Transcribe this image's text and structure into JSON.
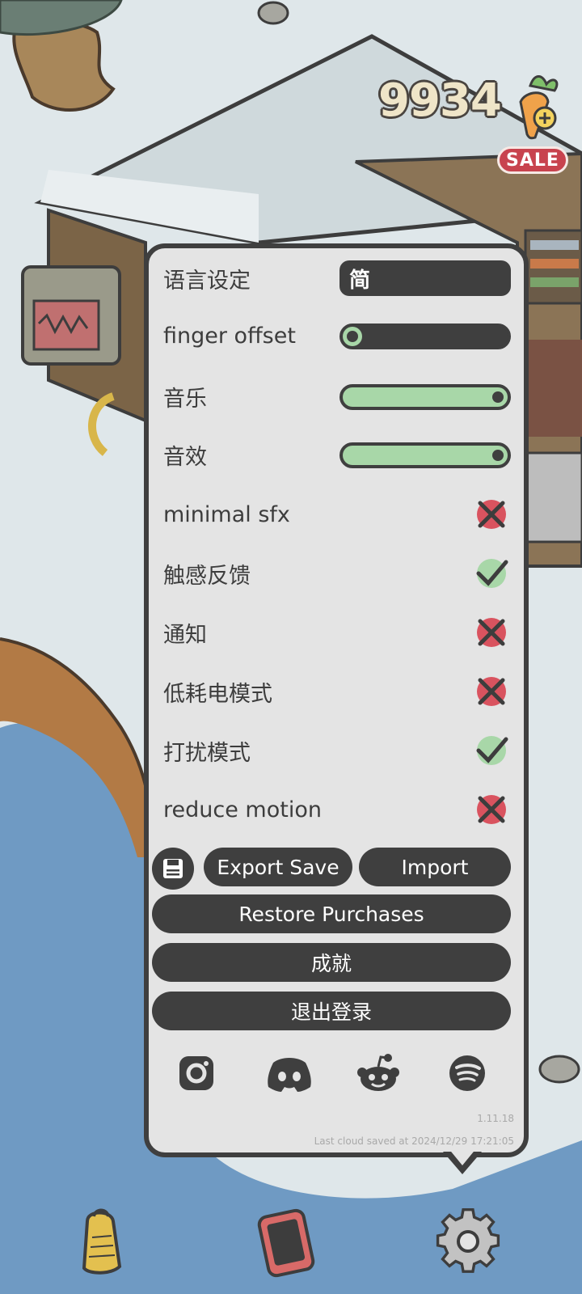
{
  "hud": {
    "carrots": "9934",
    "sale_badge": "SALE"
  },
  "settings": {
    "language": {
      "label": "语言设定",
      "value": "简"
    },
    "finger_offset": {
      "label": "finger offset",
      "level": 0.12
    },
    "music": {
      "label": "音乐",
      "level": 1.0
    },
    "sfx": {
      "label": "音效",
      "level": 1.0
    },
    "toggles": [
      {
        "label": "minimal sfx",
        "on": false
      },
      {
        "label": "触感反馈",
        "on": true
      },
      {
        "label": "通知",
        "on": false
      },
      {
        "label": "低耗电模式",
        "on": false
      },
      {
        "label": "打扰模式",
        "on": true
      },
      {
        "label": "reduce motion",
        "on": false
      }
    ],
    "buttons": {
      "export_save": "Export Save",
      "import": "Import",
      "restore_purchases": "Restore Purchases",
      "achievements": "成就",
      "logout": "退出登录"
    },
    "social_icons": [
      "instagram-icon",
      "discord-icon",
      "reddit-icon",
      "spotify-icon"
    ],
    "version": "1.11.18",
    "cloud_save": "Last cloud saved at 2024/12/29 17:21:05"
  },
  "dock": [
    "backpack-icon",
    "phone-icon",
    "gear-icon"
  ],
  "colors": {
    "panel_bg": "#e4e4e4",
    "dark": "#3f3f3f",
    "green": "#a8d7a8",
    "red": "#d9535f",
    "sale": "#c8434e"
  }
}
